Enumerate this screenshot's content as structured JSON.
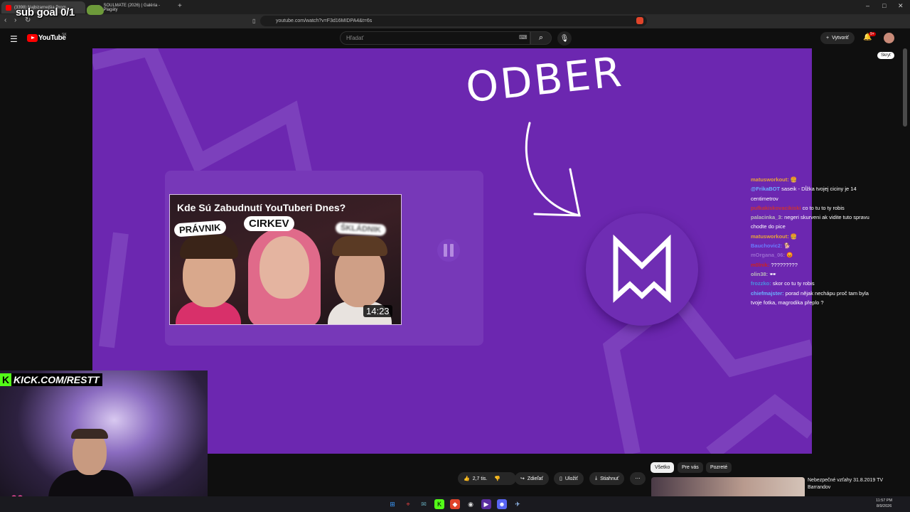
{
  "browser": {
    "tabs": [
      {
        "label": "(3398) Najbizarnejšia Prom...",
        "active": true
      },
      {
        "label": "SOULMATE (2026) | Galéria - Plagáty",
        "active": false
      }
    ],
    "new_tab": "+",
    "url": "youtube.com/watch?v=F3d16MIDPA4&t=6s",
    "window_controls": [
      "–",
      "□",
      "✕"
    ],
    "nav": [
      "‹",
      "›",
      "↻"
    ]
  },
  "overlay": {
    "sub_goal": "sub goal 0/1",
    "kick_text": "KICK.COM/RESTT",
    "kick_k": "K"
  },
  "youtube": {
    "logo": "YouTube",
    "region": "SK",
    "search_placeholder": "Hľadať",
    "create_label": "Vytvoriť",
    "bell_badge": "9+",
    "hide_label": "Skryť"
  },
  "video": {
    "odber_text": "ODBER",
    "endcard": {
      "title": "Kde Sú Zabudnutí YouTuberi Dnes?",
      "label_left": "PRÁVNIK",
      "label_center": "CIRKEV",
      "label_right": "ŠKLÁDNIK",
      "duration": "14:23"
    }
  },
  "chat": [
    {
      "user": "matusworkout:",
      "user_color": "#e8a23a",
      "text": "🍔"
    },
    {
      "user": "@FrikaBOT",
      "user_color": "#6ab0ff",
      "text": "saseik - Dĺžka tvojej ciciny je 14 centimetrov"
    },
    {
      "user": "pufkakiskovacikiski",
      "user_color": "#cc3333",
      "text": "co to tu to ty robis"
    },
    {
      "user": "palacinka_3:",
      "user_color": "#bbbbbb",
      "text": "negeri skurveni ak vidite tuto spravu chodte do pice"
    },
    {
      "user": "matusworkout:",
      "user_color": "#e8a23a",
      "text": "🍔"
    },
    {
      "user": "Bauchovic2:",
      "user_color": "#6a7aff",
      "text": "🐕"
    },
    {
      "user": "mOrgana_06:",
      "user_color": "#9a6ad0",
      "text": "😡"
    },
    {
      "user": "m0lnik:",
      "user_color": "#cc2222",
      "text": "?????????"
    },
    {
      "user": "olin38:",
      "user_color": "#bbbbbb",
      "text": "🕶"
    },
    {
      "user": "frozzko:",
      "user_color": "#4a90e2",
      "text": "skor co tu ty robis"
    },
    {
      "user": "chiefmajster:",
      "user_color": "#6ab0ff",
      "text": "porad nějak nechápu proč tam byla tvoje fotka, magrodika přeplo ?"
    }
  ],
  "actions": {
    "like_count": "2,7 tis.",
    "share": "Zdieľať",
    "save": "Uložiť",
    "download": "Stiahnuť",
    "more": "⋯"
  },
  "chips": [
    "Všetko",
    "Pre vás",
    "Pozreté"
  ],
  "recommended": {
    "title": "Nebezpečné vzťahy 31.8.2019 TV Barrandov"
  },
  "taskbar": {
    "time": "11:57 PM",
    "date": "8/9/2026"
  },
  "colors": {
    "video_bg": "#6c27b0",
    "kick_green": "#53fc18",
    "yt_red": "#ff0000"
  }
}
